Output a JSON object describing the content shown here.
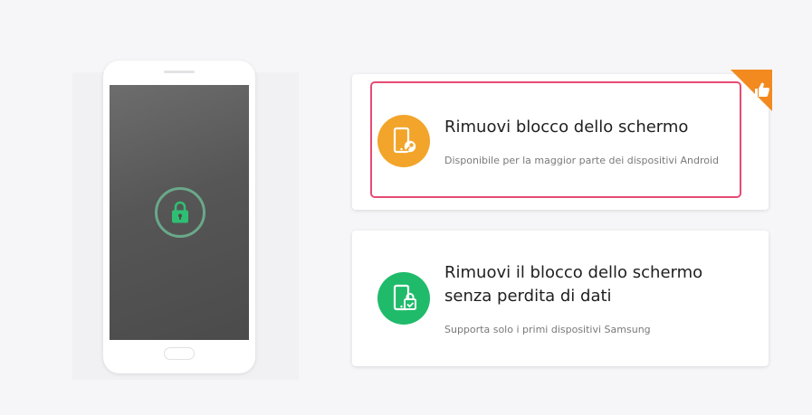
{
  "options": [
    {
      "title": "Rimuovi blocco dello schermo",
      "description": "Disponibile per la maggior parte dei dispositivi Android",
      "icon": "phone-key-icon",
      "color": "#f2a52a",
      "selected": true
    },
    {
      "title_line1": "Rimuovi il blocco dello schermo",
      "title_line2": "senza perdita di dati",
      "description": "Supporta solo i primi dispositivi Samsung",
      "icon": "phone-check-icon",
      "color": "#1fbb6a",
      "selected": false
    }
  ],
  "badge": {
    "icon": "thumbs-up-icon",
    "color": "#f28a1f"
  },
  "phone": {
    "lock_icon": "lock-icon",
    "lock_color": "#2fbf73"
  },
  "colors": {
    "highlight": "#e64b73"
  }
}
